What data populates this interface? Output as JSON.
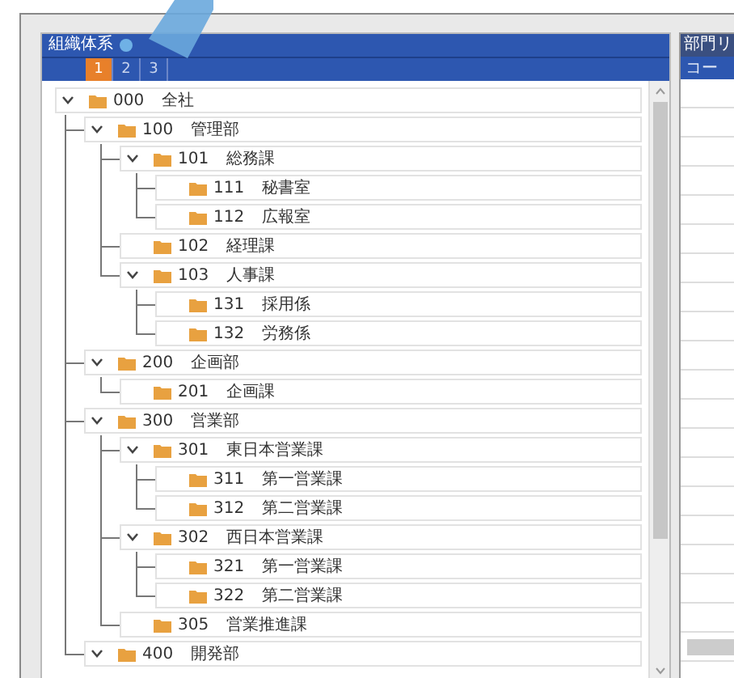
{
  "tree_panel": {
    "title": "組織体系",
    "tabs": [
      {
        "label": "1",
        "selected": true
      },
      {
        "label": "2",
        "selected": false
      },
      {
        "label": "3",
        "selected": false
      }
    ],
    "tree": [
      {
        "code": "000",
        "name": "全社",
        "expanded": true,
        "children": [
          {
            "code": "100",
            "name": "管理部",
            "expanded": true,
            "children": [
              {
                "code": "101",
                "name": "総務課",
                "expanded": true,
                "children": [
                  {
                    "code": "111",
                    "name": "秘書室"
                  },
                  {
                    "code": "112",
                    "name": "広報室"
                  }
                ]
              },
              {
                "code": "102",
                "name": "経理課"
              },
              {
                "code": "103",
                "name": "人事課",
                "expanded": true,
                "children": [
                  {
                    "code": "131",
                    "name": "採用係"
                  },
                  {
                    "code": "132",
                    "name": "労務係"
                  }
                ]
              }
            ]
          },
          {
            "code": "200",
            "name": "企画部",
            "expanded": true,
            "children": [
              {
                "code": "201",
                "name": "企画課"
              }
            ]
          },
          {
            "code": "300",
            "name": "営業部",
            "expanded": true,
            "children": [
              {
                "code": "301",
                "name": "東日本営業課",
                "expanded": true,
                "children": [
                  {
                    "code": "311",
                    "name": "第一営業課"
                  },
                  {
                    "code": "312",
                    "name": "第二営業課"
                  }
                ]
              },
              {
                "code": "302",
                "name": "西日本営業課",
                "expanded": true,
                "children": [
                  {
                    "code": "321",
                    "name": "第一営業課"
                  },
                  {
                    "code": "322",
                    "name": "第二営業課"
                  }
                ]
              },
              {
                "code": "305",
                "name": "営業推進課"
              }
            ]
          },
          {
            "code": "400",
            "name": "開発部",
            "expanded": true
          }
        ]
      }
    ]
  },
  "list_panel": {
    "title": "部門リ",
    "column_1": "コー"
  }
}
